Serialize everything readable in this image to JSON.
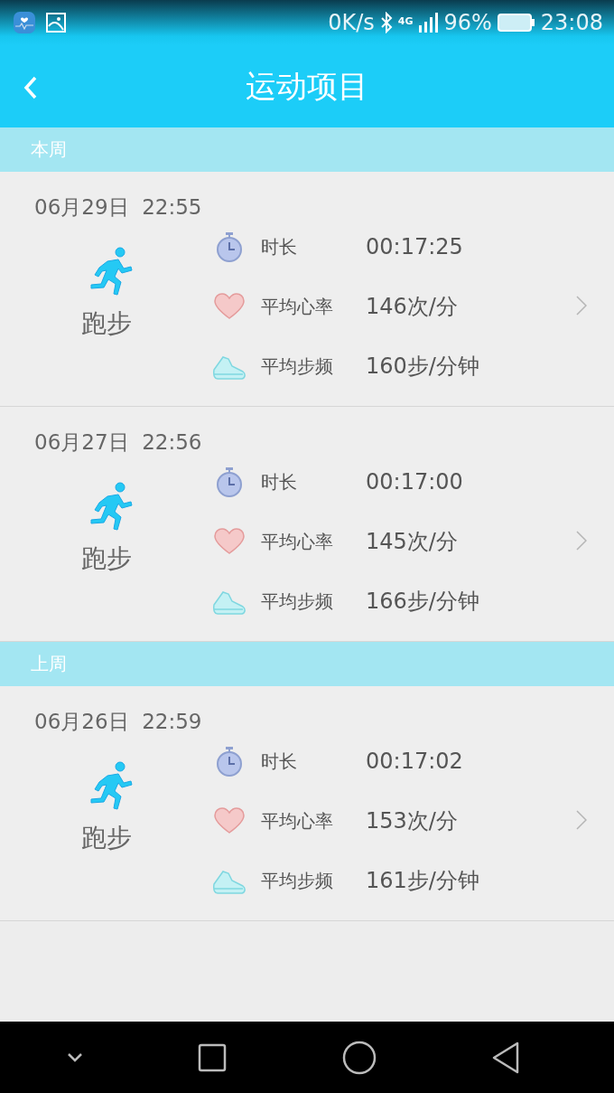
{
  "status_bar": {
    "net_speed": "0K/s",
    "network": "4G",
    "battery": "96%",
    "time": "23:08"
  },
  "header": {
    "title": "运动项目"
  },
  "sections": [
    {
      "label": "本周",
      "records": [
        {
          "date": "06月29日",
          "time": "22:55",
          "activity": "跑步",
          "stats": [
            {
              "kind": "duration",
              "label": "时长",
              "value": "00:17:25"
            },
            {
              "kind": "heart",
              "label": "平均心率",
              "value": "146次/分"
            },
            {
              "kind": "cadence",
              "label": "平均步频",
              "value": "160步/分钟"
            }
          ]
        },
        {
          "date": "06月27日",
          "time": "22:56",
          "activity": "跑步",
          "stats": [
            {
              "kind": "duration",
              "label": "时长",
              "value": "00:17:00"
            },
            {
              "kind": "heart",
              "label": "平均心率",
              "value": "145次/分"
            },
            {
              "kind": "cadence",
              "label": "平均步频",
              "value": "166步/分钟"
            }
          ]
        }
      ]
    },
    {
      "label": "上周",
      "records": [
        {
          "date": "06月26日",
          "time": "22:59",
          "activity": "跑步",
          "stats": [
            {
              "kind": "duration",
              "label": "时长",
              "value": "00:17:02"
            },
            {
              "kind": "heart",
              "label": "平均心率",
              "value": "153次/分"
            },
            {
              "kind": "cadence",
              "label": "平均步频",
              "value": "161步/分钟"
            }
          ]
        }
      ]
    }
  ]
}
